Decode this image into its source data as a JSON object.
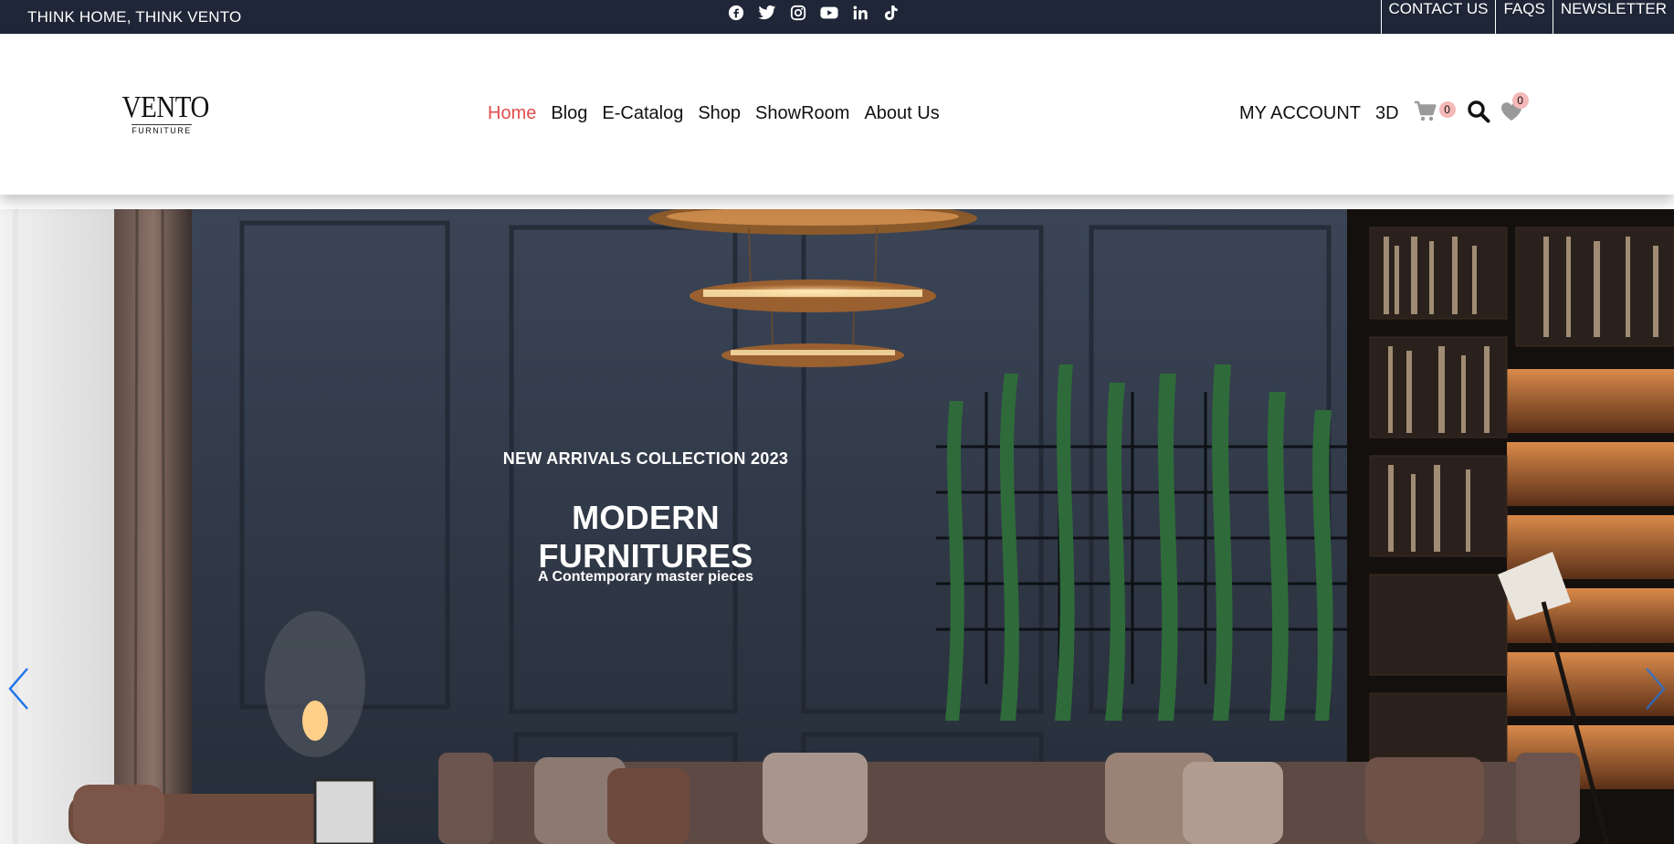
{
  "topbar": {
    "tagline": "THINK HOME, THINK VENTO",
    "socials": [
      "facebook-icon",
      "twitter-icon",
      "instagram-icon",
      "youtube-icon",
      "linkedin-icon",
      "tiktok-icon"
    ],
    "links": [
      "CONTACT US",
      "FAQS",
      "NEWSLETTER"
    ]
  },
  "header": {
    "logo_main": "VENTO",
    "logo_sub": "FURNITURE",
    "nav": [
      "Home",
      "Blog",
      "E-Catalog",
      "Shop",
      "ShowRoom",
      "About Us"
    ],
    "active_nav": "Home",
    "account_label": "MY ACCOUNT",
    "three_d_label": "3D",
    "cart_count": "0",
    "wishlist_count": "0"
  },
  "hero": {
    "kicker": "NEW ARRIVALS COLLECTION 2023",
    "title": "MODERN FURNITURES",
    "subtitle": "A Contemporary master pieces"
  },
  "colors": {
    "topbar_bg": "#1e2637",
    "accent": "#e24d4d",
    "badge": "#f4b8b8",
    "arrow": "#1a73e8"
  }
}
